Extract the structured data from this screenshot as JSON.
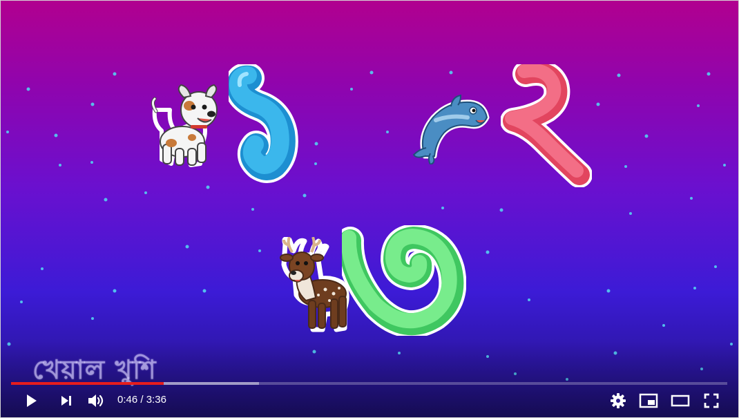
{
  "video": {
    "digits": [
      "১",
      "২",
      "৩"
    ],
    "animals": [
      "dog",
      "dolphin",
      "deer"
    ],
    "watermark_text": "খেয়াল খুশি",
    "colors": {
      "digit_one": "#3bb7ec",
      "digit_two": "#f36e86",
      "digit_three": "#78ec8c",
      "progress_played": "#e61d1d"
    }
  },
  "player": {
    "current_time": "0:46",
    "duration": "3:36",
    "progress_fraction": 0.213,
    "buffered_fraction": 0.346,
    "controls": {
      "left": [
        "play-icon",
        "next-icon",
        "volume-icon"
      ],
      "right": [
        "gear-icon",
        "miniplayer-icon",
        "theater-icon",
        "fullscreen-icon"
      ]
    }
  }
}
